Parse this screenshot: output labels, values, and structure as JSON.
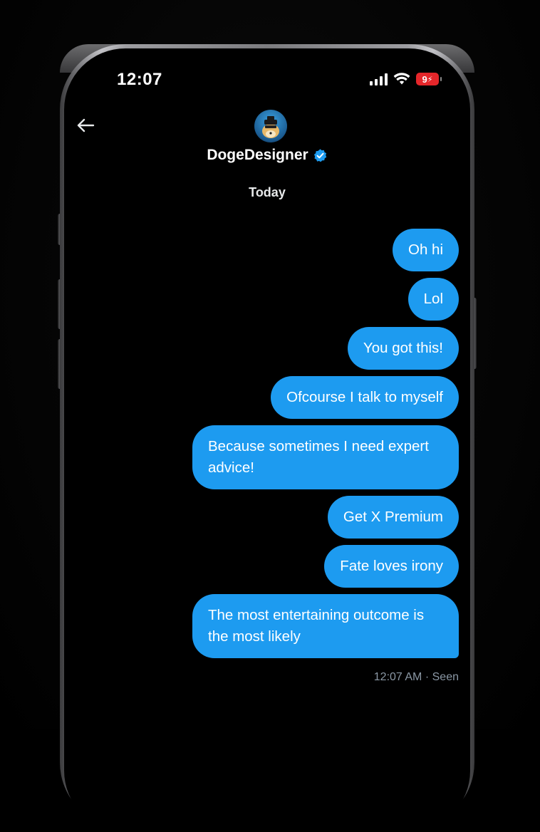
{
  "status_bar": {
    "time": "12:07",
    "battery_level": "9",
    "battery_color": "#e5262a"
  },
  "header": {
    "back_icon": "arrow-left-icon",
    "contact_name": "DogeDesigner",
    "verified_icon": "verified-badge-icon",
    "verified_color": "#1d9bf0"
  },
  "conversation": {
    "date_separator": "Today",
    "bubble_color": "#1d9bf0",
    "messages": [
      {
        "text": "Oh hi"
      },
      {
        "text": "Lol"
      },
      {
        "text": "You got this!"
      },
      {
        "text": "Ofcourse I talk to myself"
      },
      {
        "text": "Because sometimes I need expert advice!"
      },
      {
        "text": "Get X Premium"
      },
      {
        "text": "Fate loves irony"
      },
      {
        "text": "The most entertaining outcome is the most likely"
      }
    ],
    "last_message_time": "12:07 AM",
    "separator": "·",
    "read_status": "Seen"
  }
}
